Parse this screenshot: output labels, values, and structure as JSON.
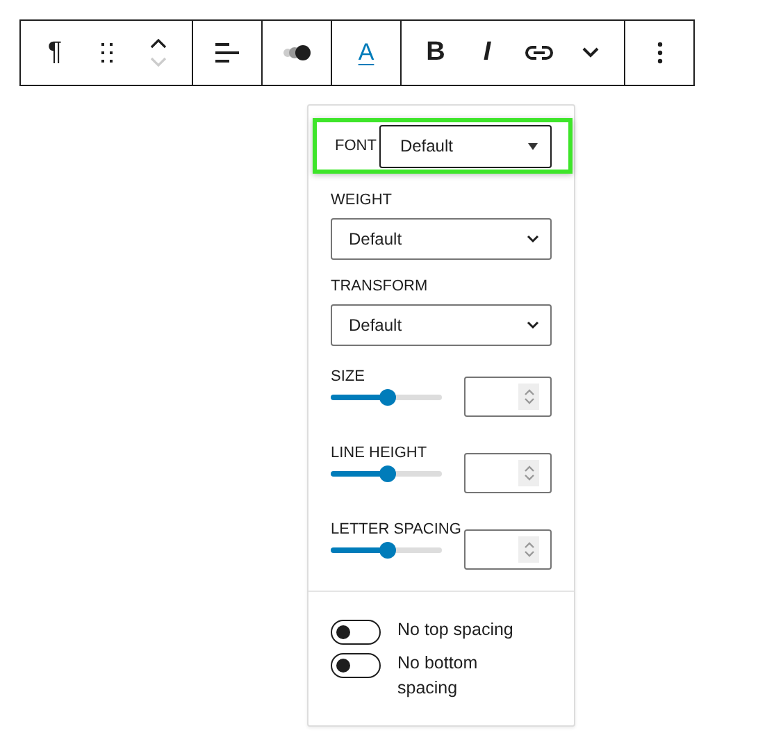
{
  "toolbar": {
    "groups": [
      {
        "items": [
          {
            "kind": "glyph",
            "label": "¶",
            "active": false
          },
          {
            "kind": "drag"
          },
          {
            "kind": "mover",
            "down_disabled": true
          }
        ]
      },
      {
        "items": [
          {
            "kind": "align"
          }
        ]
      },
      {
        "items": [
          {
            "kind": "dots"
          }
        ]
      },
      {
        "items": [
          {
            "kind": "underline-glyph",
            "label": "A",
            "active": true
          }
        ]
      },
      {
        "items": [
          {
            "kind": "bold-glyph",
            "label": "B",
            "active": false
          },
          {
            "kind": "italic-glyph",
            "label": "I",
            "active": false
          },
          {
            "kind": "link"
          },
          {
            "kind": "chevron"
          }
        ]
      },
      {
        "items": [
          {
            "kind": "more"
          }
        ]
      }
    ]
  },
  "panel": {
    "font": {
      "label": "FONT",
      "value": "Default",
      "highlighted": true
    },
    "selects": [
      {
        "label": "WEIGHT",
        "value": "Default"
      },
      {
        "label": "TRANSFORM",
        "value": "Default"
      }
    ],
    "sliders": [
      {
        "label": "SIZE",
        "level": 0.51
      },
      {
        "label": "LINE HEIGHT",
        "level": 0.51
      },
      {
        "label": "LETTER SPACING",
        "level": 0.51
      }
    ],
    "toggles": [
      {
        "label": "No top spacing",
        "on": false
      },
      {
        "label": "No bottom spacing",
        "on": false
      }
    ]
  }
}
